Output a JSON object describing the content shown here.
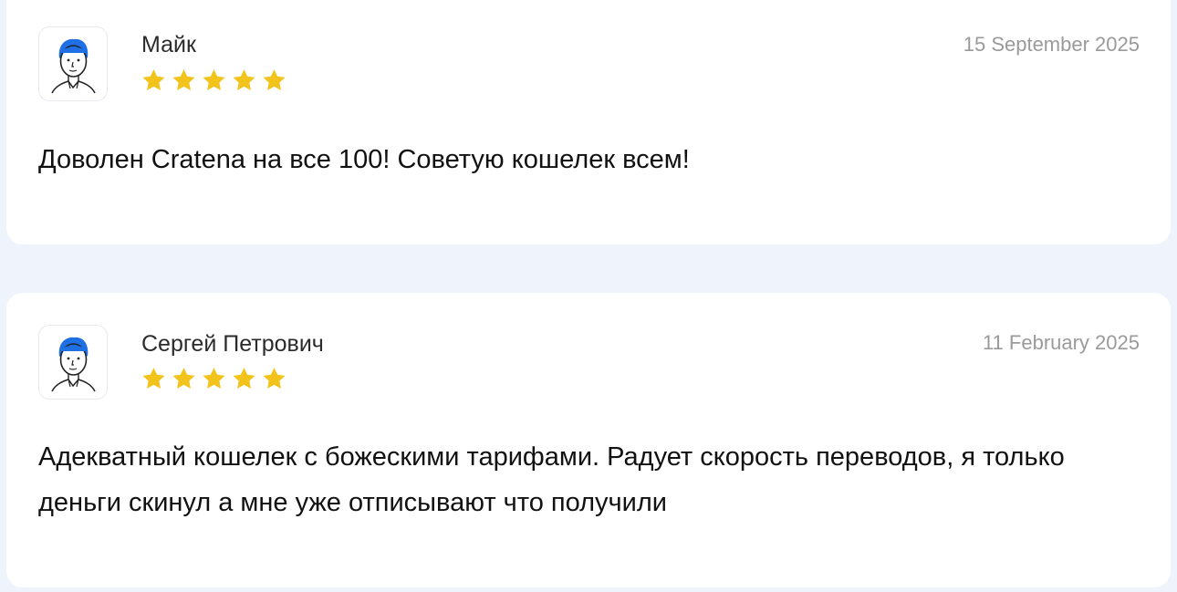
{
  "reviews": [
    {
      "author": "Майк",
      "date": "15 September 2025",
      "rating": 5,
      "text": "Доволен Cratena на все 100! Советую кошелек всем!"
    },
    {
      "author": "Сергей Петрович",
      "date": "11 February 2025",
      "rating": 5,
      "text": "Адекватный кошелек с божескими тарифами. Радует скорость переводов, я только деньги скинул а мне уже отписывают что получили"
    }
  ],
  "colors": {
    "page_background": "#eff3fb",
    "card_background": "#ffffff",
    "star": "#f2c31b",
    "avatar_hair": "#1f6fe5",
    "date_text": "#9a9a9a"
  },
  "icons": {
    "avatar": "user-avatar-icon",
    "star": "star-icon"
  }
}
